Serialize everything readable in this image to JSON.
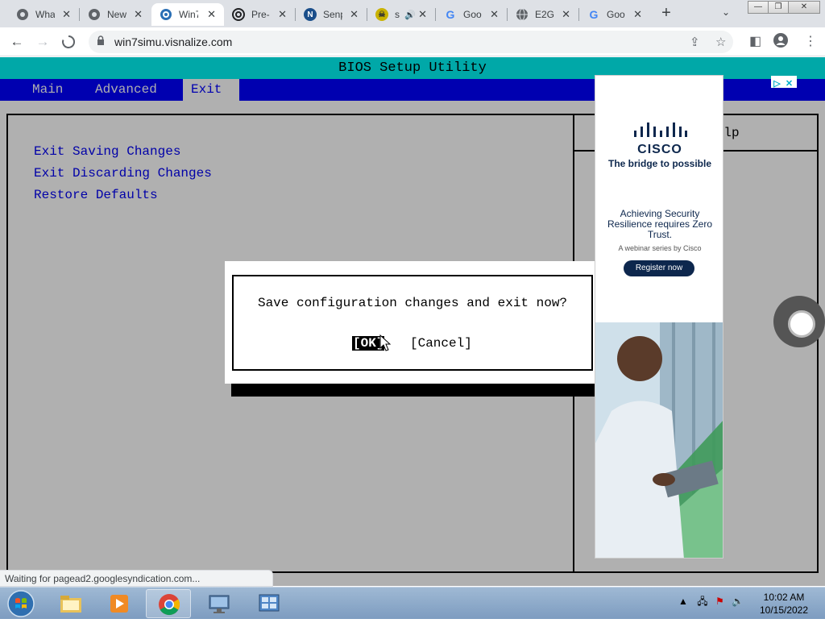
{
  "browser": {
    "tabs": [
      {
        "title": "What",
        "icon": "chrome-icon",
        "active": false
      },
      {
        "title": "New",
        "icon": "chrome-icon",
        "active": false
      },
      {
        "title": "Win7",
        "icon": "win7sim-icon",
        "active": true
      },
      {
        "title": "Pre-",
        "icon": "spiral-icon",
        "active": false
      },
      {
        "title": "Senp",
        "icon": "n-logo-icon",
        "active": false
      },
      {
        "title": "s",
        "icon": "skull-icon",
        "active": false,
        "audio": true
      },
      {
        "title": "Goo",
        "icon": "google-icon",
        "active": false
      },
      {
        "title": "E2G",
        "icon": "globe-icon",
        "active": false
      },
      {
        "title": "Goo",
        "icon": "google-icon",
        "active": false
      }
    ],
    "url": "win7simu.visnalize.com",
    "status_text": "Waiting for pagead2.googlesyndication.com..."
  },
  "bios": {
    "title": "BIOS Setup Utility",
    "menu": [
      "Main",
      "Advanced",
      "Exit"
    ],
    "selected_menu": "Exit",
    "options": [
      "Exit Saving Changes",
      "Exit Discarding Changes",
      "Restore Defaults"
    ],
    "help_label": "c Help",
    "dialog": {
      "message": "Save configuration changes and exit now?",
      "ok_label": "[OK]",
      "cancel_label": "[Cancel]"
    }
  },
  "ad": {
    "brand": "CISCO",
    "tagline": "The bridge to possible",
    "headline": "Achieving Security Resilience requires Zero Trust.",
    "subline": "A webinar series by Cisco",
    "cta": "Register now"
  },
  "taskbar": {
    "time": "10:02 AM",
    "date": "10/15/2022"
  },
  "colors": {
    "bios_bg": "#b0b0b0",
    "bios_title_bar": "#00a8a8",
    "bios_menu_bar": "#0000b0",
    "bios_option_text": "#0000a8"
  }
}
